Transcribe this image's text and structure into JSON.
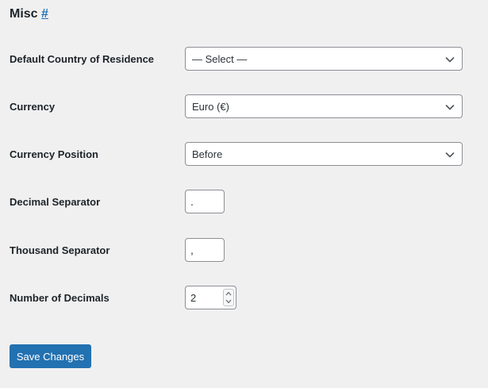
{
  "section": {
    "title": "Misc",
    "anchor": "#"
  },
  "fields": {
    "country": {
      "label": "Default Country of Residence",
      "value": "— Select —"
    },
    "currency": {
      "label": "Currency",
      "value": "Euro (€)"
    },
    "currency_position": {
      "label": "Currency Position",
      "value": "Before"
    },
    "decimal_separator": {
      "label": "Decimal Separator",
      "value": "."
    },
    "thousand_separator": {
      "label": "Thousand Separator",
      "value": ","
    },
    "number_of_decimals": {
      "label": "Number of Decimals",
      "value": "2"
    }
  },
  "actions": {
    "save_label": "Save Changes"
  },
  "colors": {
    "accent": "#2271b1",
    "background": "#f0f0f1",
    "border": "#8c8f94"
  },
  "icons": {
    "select_arrow": "chevron-down-icon",
    "spinner_up": "caret-up-icon",
    "spinner_down": "caret-down-icon"
  }
}
